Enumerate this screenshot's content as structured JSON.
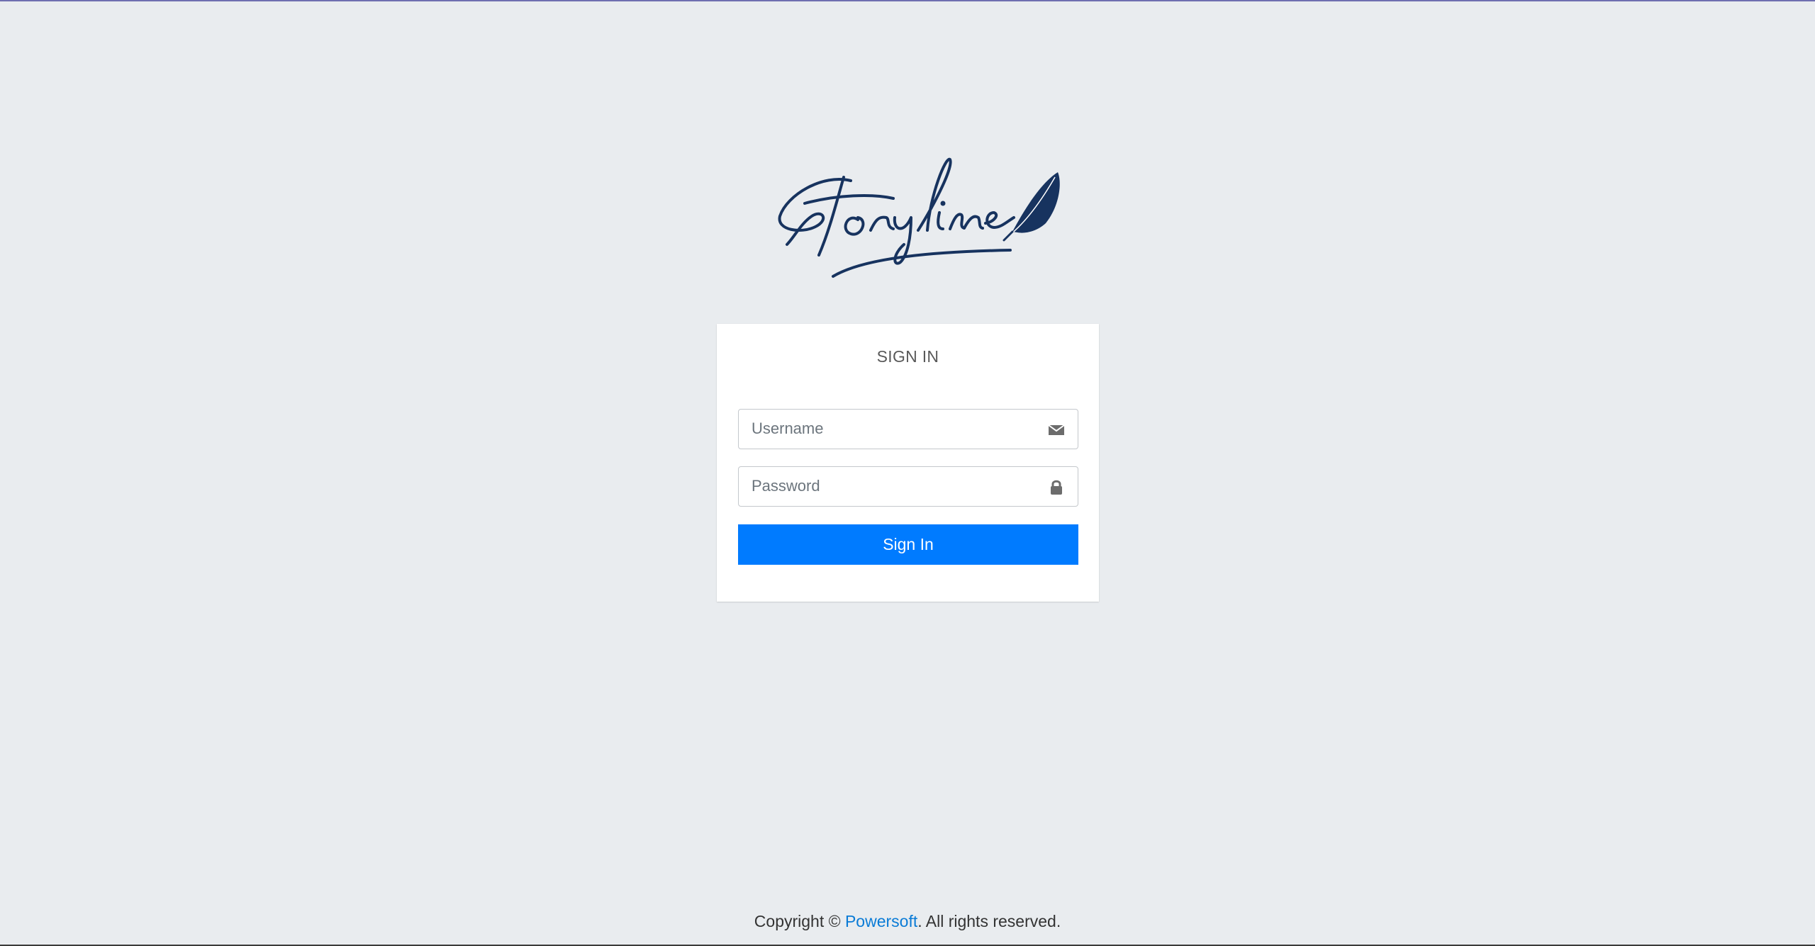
{
  "brand": {
    "logo_text": "Storyline",
    "logo_color": "#17335f"
  },
  "login": {
    "title": "SIGN IN",
    "username_placeholder": "Username",
    "username_icon": "envelope-icon",
    "password_placeholder": "Password",
    "password_icon": "lock-icon",
    "submit_label": "Sign In",
    "accent_color": "#007bff"
  },
  "footer": {
    "prefix": "Copyright © ",
    "company": "Powersoft",
    "suffix": ". All rights reserved."
  }
}
